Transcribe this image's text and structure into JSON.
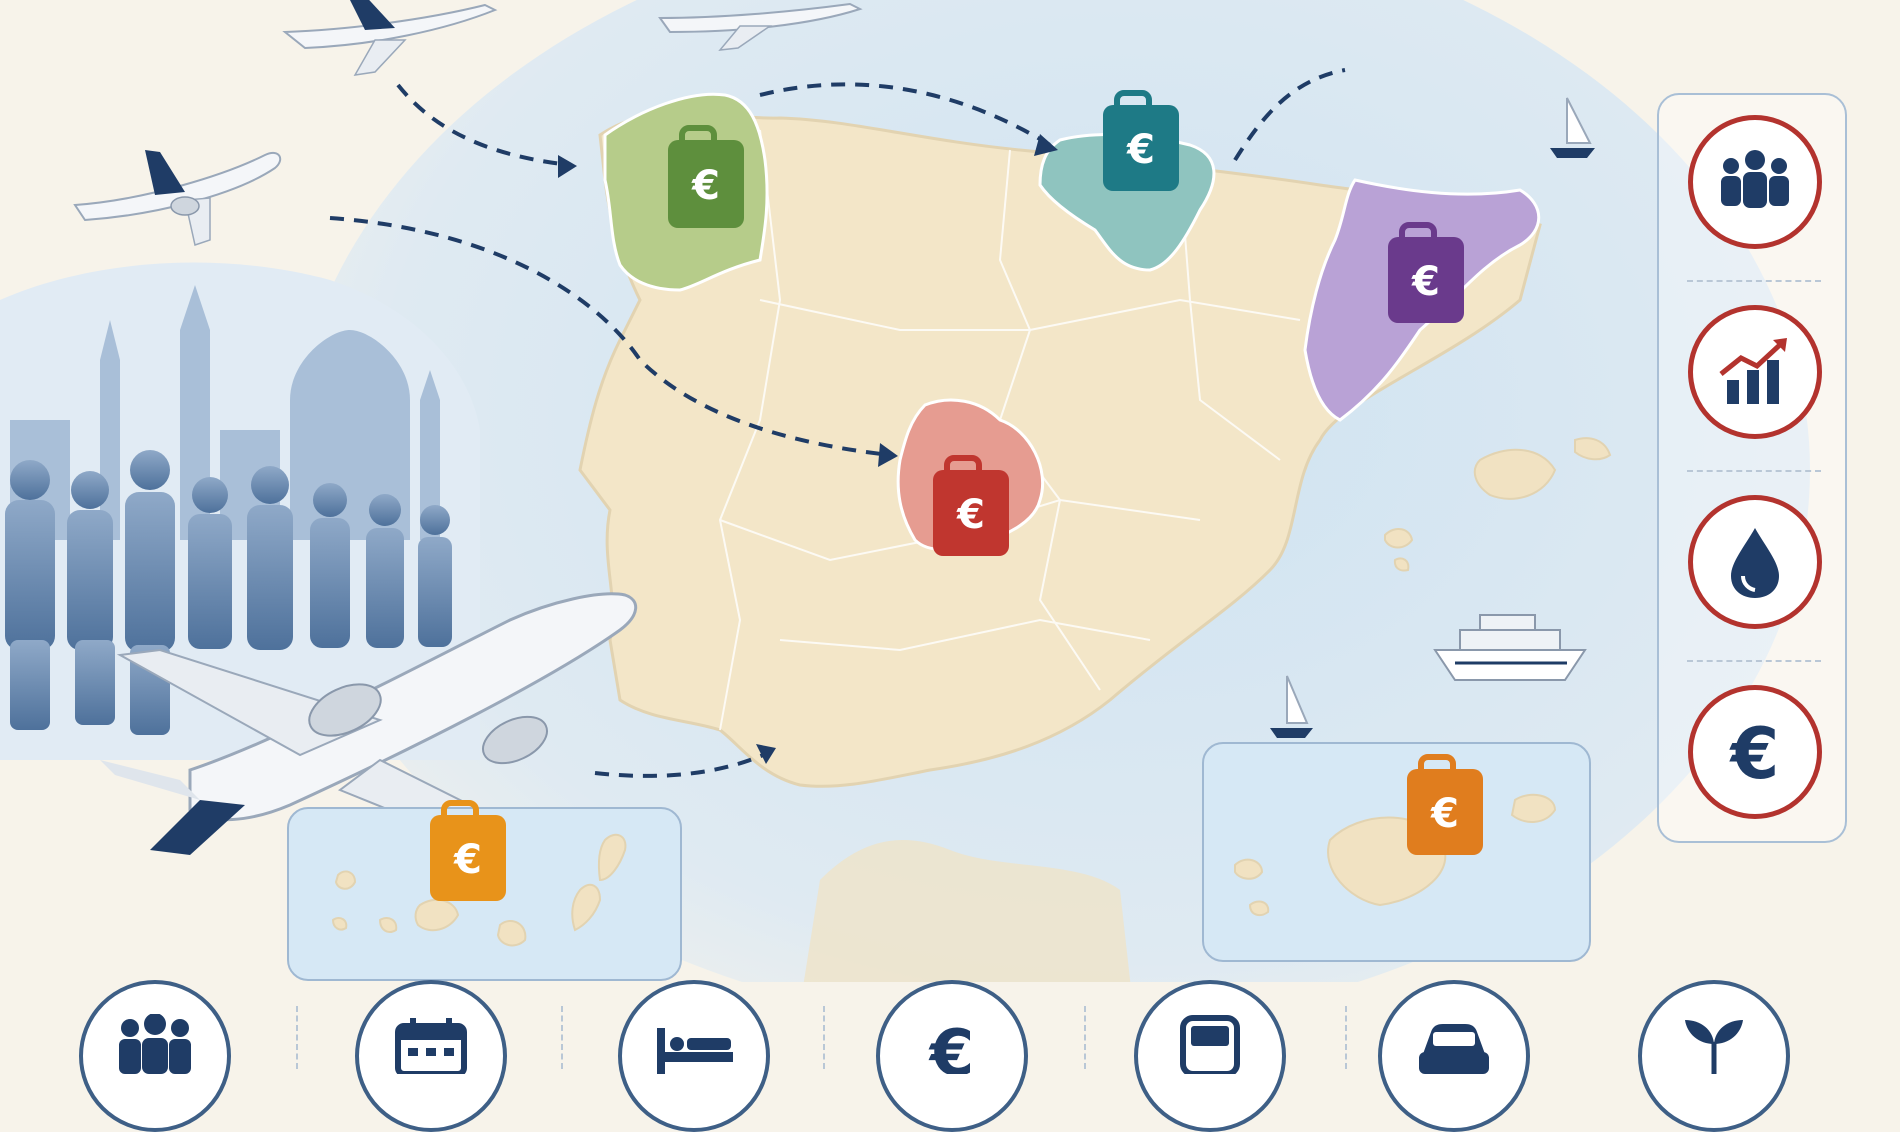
{
  "currency_symbol": "€",
  "colors": {
    "sea": "#d9e8f3",
    "land": "#f3e6c8",
    "region_outline": "#ffffff",
    "flight_path": "#1f3c66",
    "accent_red": "#b3332e",
    "icon_blue": "#1f3c66"
  },
  "regions": [
    {
      "name": "galicia",
      "color": "#b6cc8a",
      "badge_color": "#5e8f3d"
    },
    {
      "name": "basque-country",
      "color": "#8fc4bf",
      "badge_color": "#1e7a86"
    },
    {
      "name": "catalonia",
      "color": "#b9a2d6",
      "badge_color": "#6a3a8c"
    },
    {
      "name": "madrid",
      "color": "#e69c91",
      "badge_color": "#c0362f"
    },
    {
      "name": "canary-islands",
      "color": "#f1e2c2",
      "badge_color": "#e8931a"
    },
    {
      "name": "balearic-islands",
      "color": "#f1e2c2",
      "badge_color": "#e07d1e"
    }
  ],
  "side_icons": [
    "people-group-icon",
    "growth-chart-icon",
    "water-drop-icon",
    "euro-icon"
  ],
  "bottom_icons": [
    "people-group-icon",
    "calendar-icon",
    "bed-icon",
    "euro-icon",
    "bus-icon",
    "car-icon",
    "sprout-icon"
  ],
  "decorations": [
    "airplane-icon",
    "airplane-icon",
    "airplane-icon",
    "airplane-icon",
    "sailboat-icon",
    "sailboat-icon",
    "cruise-ship-icon",
    "city-skyline",
    "tourist-crowd"
  ]
}
